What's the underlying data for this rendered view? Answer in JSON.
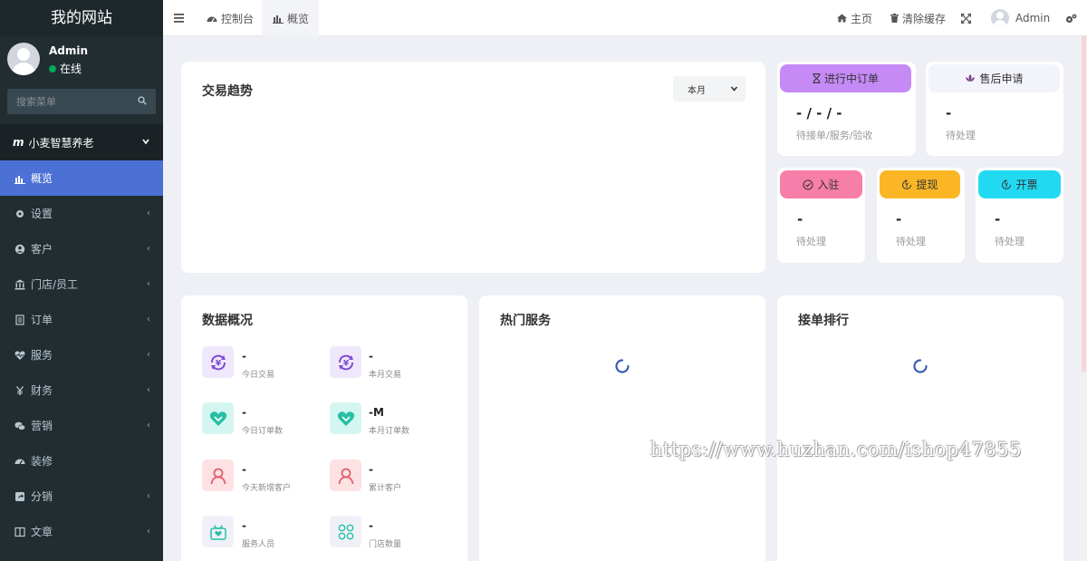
{
  "sidebar": {
    "logo": "我的网站",
    "user": {
      "name": "Admin",
      "status": "在线"
    },
    "search_placeholder": "搜索菜单",
    "group": {
      "icon_text": "m",
      "label": "小麦智慧养老"
    },
    "items": [
      {
        "label": "概览",
        "icon": "bar-chart-icon",
        "active": true
      },
      {
        "label": "设置",
        "icon": "gear-icon"
      },
      {
        "label": "客户",
        "icon": "user-circle-icon"
      },
      {
        "label": "门店/员工",
        "icon": "bank-icon"
      },
      {
        "label": "订单",
        "icon": "document-icon"
      },
      {
        "label": "服务",
        "icon": "heartbeat-icon"
      },
      {
        "label": "财务",
        "icon": "yen-icon"
      },
      {
        "label": "营销",
        "icon": "wechat-icon"
      },
      {
        "label": "装修",
        "icon": "dashboard-icon"
      },
      {
        "label": "分销",
        "icon": "share-icon"
      },
      {
        "label": "文章",
        "icon": "columns-icon"
      }
    ],
    "arrow": "‹"
  },
  "topbar": {
    "tabs": [
      {
        "label": "控制台"
      },
      {
        "label": "概览"
      }
    ],
    "right": {
      "home": "主页",
      "clear_cache": "清除缓存",
      "user": "Admin"
    }
  },
  "trend": {
    "title": "交易趋势",
    "period": "本月"
  },
  "orders": {
    "label": "进行中订单",
    "value": "- / - / -",
    "sub": "待接单/服务/验收"
  },
  "after_sale": {
    "label": "售后申请",
    "value": "-",
    "sub": "待处理"
  },
  "small_cards": [
    {
      "label": "入驻",
      "value": "-",
      "sub": "待处理",
      "color": "#f77ea8"
    },
    {
      "label": "提现",
      "value": "-",
      "sub": "待处理",
      "color": "#fbb626"
    },
    {
      "label": "开票",
      "value": "-",
      "sub": "待处理",
      "color": "#22d9f2"
    }
  ],
  "overview": {
    "title": "数据概况",
    "stats": [
      {
        "value": "-",
        "label": "今日交易"
      },
      {
        "value": "-",
        "label": "本月交易"
      },
      {
        "value": "-",
        "label": "今日订单数"
      },
      {
        "value": "-M",
        "label": "本月订单数"
      },
      {
        "value": "-",
        "label": "今天新增客户"
      },
      {
        "value": "-",
        "label": "累计客户"
      },
      {
        "value": "-",
        "label": "服务人员"
      },
      {
        "value": "-",
        "label": "门店数量"
      }
    ]
  },
  "hot_services": {
    "title": "热门服务"
  },
  "ranking": {
    "title": "接单排行"
  },
  "watermark": "https://www.huzhan.com/ishop47855",
  "colors": {
    "accent": "#4b71d6",
    "sidebar": "#222d32",
    "orders_pill": "#c58af6",
    "online": "#00a65a"
  }
}
